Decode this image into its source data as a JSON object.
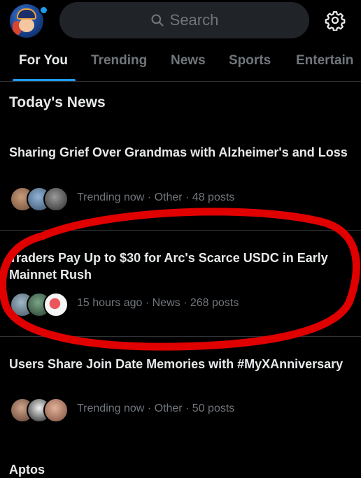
{
  "header": {
    "search_placeholder": "Search",
    "settings_icon": "gear-icon",
    "search_icon": "search-icon"
  },
  "tabs": [
    "For You",
    "Trending",
    "News",
    "Sports",
    "Entertain"
  ],
  "section_title": "Today's News",
  "stories": [
    {
      "title": "Sharing Grief Over Grandmas with Alzheimer's and Loss",
      "meta": "Trending now · Other · 48 posts"
    },
    {
      "title": "Traders Pay Up to $30 for Arc's Scarce USDC in Early Mainnet Rush",
      "meta": "15 hours ago · News · 268 posts"
    },
    {
      "title": "Users Share Join Date Memories with #MyXAnniversary",
      "meta": "Trending now · Other · 50 posts"
    },
    {
      "title": "Aptos"
    }
  ],
  "colors": {
    "accent": "#1d9bf0",
    "annotation": "#e00000"
  }
}
